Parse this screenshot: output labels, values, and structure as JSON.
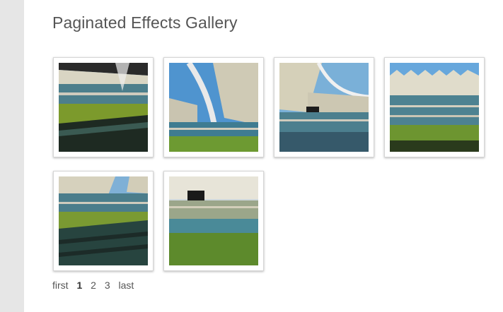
{
  "page": {
    "title": "Paginated Effects Gallery"
  },
  "gallery": {
    "thumbnails": [
      {
        "name": "stadium-photo-1",
        "subject": "stadium pitch and stands with roof"
      },
      {
        "name": "stadium-photo-2",
        "subject": "stadium arch and roof against sky"
      },
      {
        "name": "stadium-photo-3",
        "subject": "stadium stands with scoreboard under roof"
      },
      {
        "name": "stadium-photo-4",
        "subject": "stadium roof canopy over stands and pitch"
      },
      {
        "name": "stadium-photo-5",
        "subject": "stadium lower stands and pitch"
      },
      {
        "name": "stadium-photo-6",
        "subject": "stadium scoreboard above stands and pitch"
      }
    ]
  },
  "pagination": {
    "first": "first",
    "pages": [
      "1",
      "2",
      "3"
    ],
    "current": "1",
    "last": "last"
  },
  "colors": {
    "sky": "#5b9fd6",
    "roof": "#d8d4c2",
    "stands_blue": "#3f7f93",
    "pitch": "#5f8a2a",
    "shadow": "#1b2418"
  }
}
